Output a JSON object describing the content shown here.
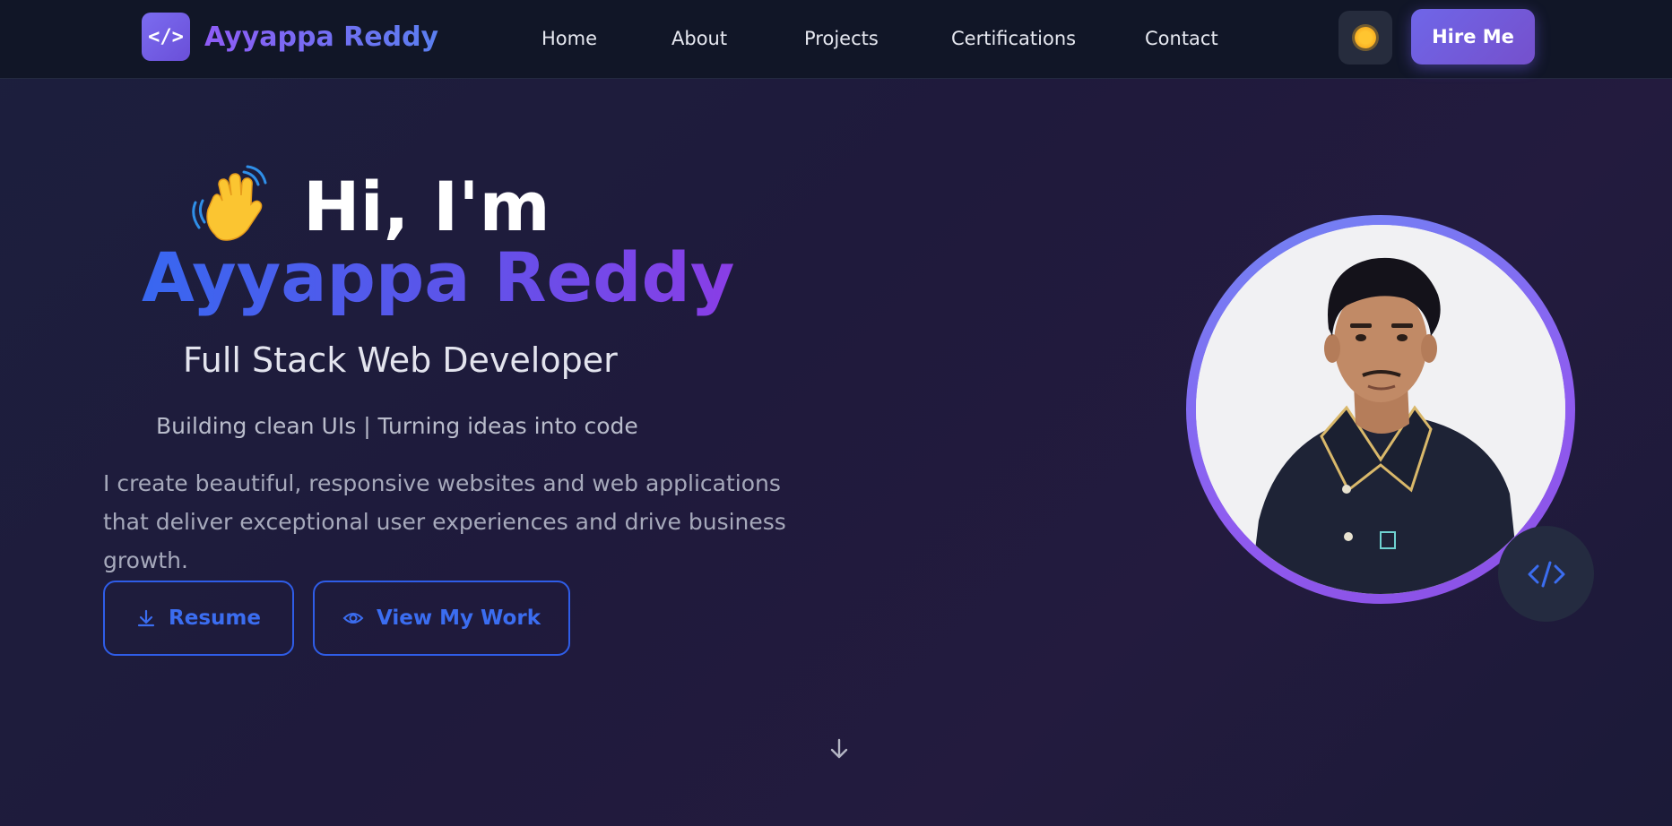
{
  "nav": {
    "logo_icon": "</>",
    "brand": "Ayyappa Reddy",
    "links": [
      "Home",
      "About",
      "Projects",
      "Certifications",
      "Contact"
    ],
    "theme_icon": "sun-icon",
    "hire_label": "Hire Me"
  },
  "hero": {
    "greeting_emoji": "waving-hand-icon",
    "greeting": "Hi, I'm",
    "name": "Ayyappa Reddy",
    "role": "Full Stack Web Developer",
    "tagline": "Building clean UIs | Turning ideas into code",
    "description": "I create beautiful, responsive websites and web applications that deliver exceptional user experiences and drive business growth.",
    "resume_label": "Resume",
    "work_label": "View My Work"
  },
  "profile": {
    "badge_icon": "code-icon"
  },
  "colors": {
    "accent_blue": "#2f5de8",
    "accent_purple": "#8a3de6",
    "nav_bg": "#111627"
  }
}
